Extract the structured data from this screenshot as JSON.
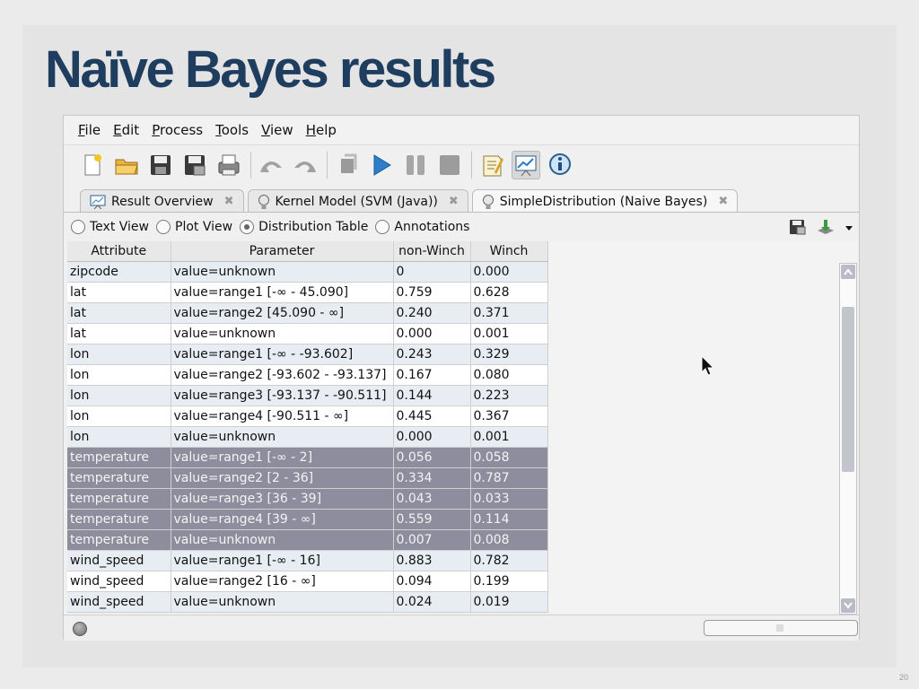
{
  "slide": {
    "title": "Naïve Bayes results",
    "page_number": "20"
  },
  "menu": [
    "File",
    "Edit",
    "Process",
    "Tools",
    "View",
    "Help"
  ],
  "toolbar": {
    "icons": [
      "new-file-icon",
      "open-folder-icon",
      "save-icon",
      "save-as-icon",
      "print-icon",
      "undo-icon",
      "redo-icon",
      "breakpoint-icon",
      "run-icon",
      "pause-icon",
      "stop-icon",
      "design-view-icon",
      "results-view-icon",
      "info-icon"
    ]
  },
  "tabs": [
    {
      "label": "Result Overview",
      "icon": "result-overview-icon"
    },
    {
      "label": "Kernel Model (SVM (Java))",
      "icon": "lightbulb-icon"
    },
    {
      "label": "SimpleDistribution (Naive Bayes)",
      "icon": "lightbulb-icon"
    }
  ],
  "view_options": [
    {
      "label": "Text View",
      "selected": false
    },
    {
      "label": "Plot View",
      "selected": false
    },
    {
      "label": "Distribution Table",
      "selected": true
    },
    {
      "label": "Annotations",
      "selected": false
    }
  ],
  "table": {
    "columns": [
      "Attribute",
      "Parameter",
      "non-Winch",
      "Winch"
    ],
    "rows": [
      [
        "zipcode",
        "value=unknown",
        "0",
        "0.000"
      ],
      [
        "lat",
        "value=range1 [-∞ - 45.090]",
        "0.759",
        "0.628"
      ],
      [
        "lat",
        "value=range2 [45.090 - ∞]",
        "0.240",
        "0.371"
      ],
      [
        "lat",
        "value=unknown",
        "0.000",
        "0.001"
      ],
      [
        "lon",
        "value=range1 [-∞ - -93.602]",
        "0.243",
        "0.329"
      ],
      [
        "lon",
        "value=range2 [-93.602 - -93.137]",
        "0.167",
        "0.080"
      ],
      [
        "lon",
        "value=range3 [-93.137 - -90.511]",
        "0.144",
        "0.223"
      ],
      [
        "lon",
        "value=range4 [-90.511 - ∞]",
        "0.445",
        "0.367"
      ],
      [
        "lon",
        "value=unknown",
        "0.000",
        "0.001"
      ],
      [
        "temperature",
        "value=range1 [-∞ - 2]",
        "0.056",
        "0.058"
      ],
      [
        "temperature",
        "value=range2 [2 - 36]",
        "0.334",
        "0.787"
      ],
      [
        "temperature",
        "value=range3 [36 - 39]",
        "0.043",
        "0.033"
      ],
      [
        "temperature",
        "value=range4 [39 - ∞]",
        "0.559",
        "0.114"
      ],
      [
        "temperature",
        "value=unknown",
        "0.007",
        "0.008"
      ],
      [
        "wind_speed",
        "value=range1 [-∞ - 16]",
        "0.883",
        "0.782"
      ],
      [
        "wind_speed",
        "value=range2 [16 - ∞]",
        "0.094",
        "0.199"
      ],
      [
        "wind_speed",
        "value=unknown",
        "0.024",
        "0.019"
      ]
    ],
    "selected_attribute": "temperature"
  }
}
